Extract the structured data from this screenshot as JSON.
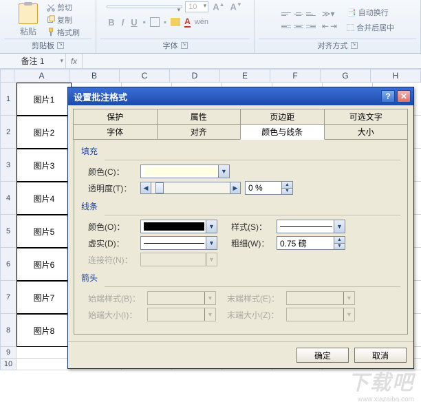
{
  "ribbon": {
    "clipboard": {
      "label": "剪贴板",
      "paste": "粘贴",
      "cut": "剪切",
      "copy": "复制",
      "fmtpainter": "格式刷"
    },
    "font": {
      "label": "字体",
      "size": "10"
    },
    "align": {
      "label": "对齐方式",
      "wrap": "自动换行",
      "merge": "合并后居中"
    }
  },
  "namebox": "备注 1",
  "columns": [
    "A",
    "B",
    "C",
    "D",
    "E",
    "F",
    "G",
    "H"
  ],
  "rows": [
    "1",
    "2",
    "3",
    "4",
    "5",
    "6",
    "7",
    "8",
    "9",
    "10"
  ],
  "imgcells": [
    "图片1",
    "图片2",
    "图片3",
    "图片4",
    "图片5",
    "图片6",
    "图片7",
    "图片8"
  ],
  "dialog": {
    "title": "设置批注格式",
    "tabs_row1": [
      "保护",
      "属性",
      "页边距",
      "可选文字"
    ],
    "tabs_row2": [
      "字体",
      "对齐",
      "颜色与线条",
      "大小"
    ],
    "fill": {
      "title": "填充",
      "color_lbl": "颜色(C)：",
      "trans_lbl": "透明度(T)：",
      "trans_val": "0 %"
    },
    "line": {
      "title": "线条",
      "color_lbl": "颜色(O)：",
      "style_lbl": "样式(S)：",
      "dash_lbl": "虚实(D)：",
      "weight_lbl": "粗细(W)：",
      "weight_val": "0.75 磅",
      "conn_lbl": "连接符(N)："
    },
    "arrow": {
      "title": "箭头",
      "begin_style": "始端样式(B)：",
      "end_style": "末端样式(E)：",
      "begin_size": "始端大小(I)：",
      "end_size": "末端大小(Z)："
    },
    "ok": "确定",
    "cancel": "取消"
  },
  "watermark": "下载吧",
  "watermark_url": "www.xiazaiba.com"
}
